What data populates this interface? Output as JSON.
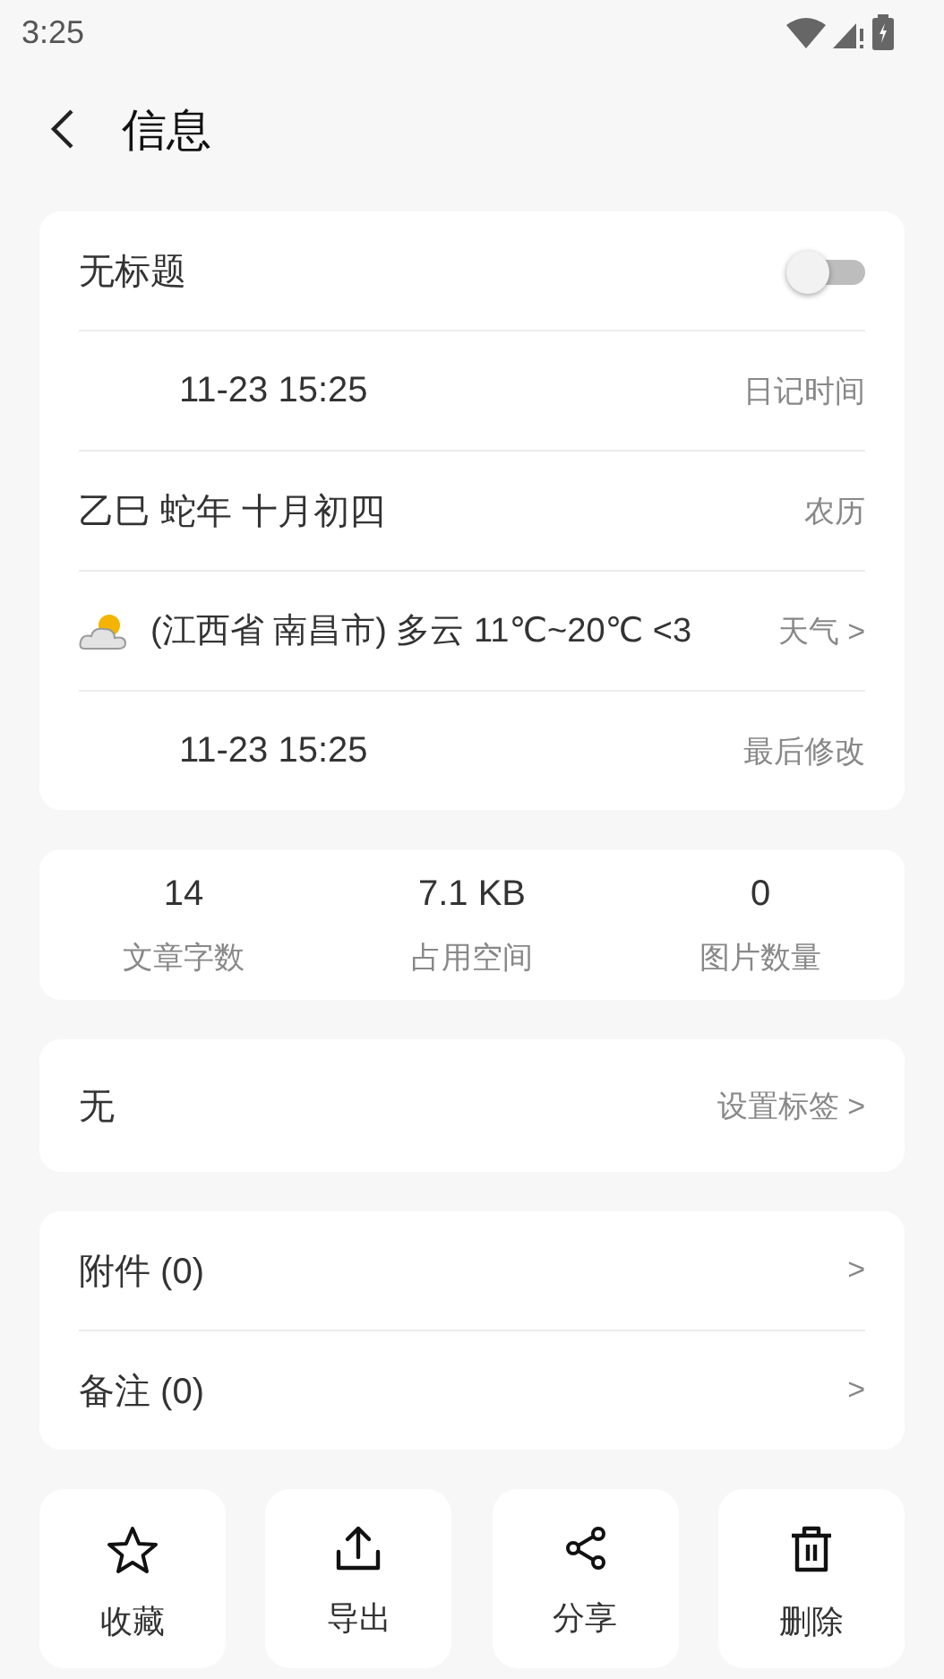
{
  "status_bar": {
    "time": "3:25"
  },
  "header": {
    "title": "信息"
  },
  "info": {
    "title": "无标题",
    "title_switch_on": false,
    "rows": [
      {
        "kind": "date",
        "value": "11-23 15:25",
        "label": "日记时间"
      },
      {
        "kind": "text",
        "value": "乙巳 蛇年 十月初四",
        "label": "农历"
      },
      {
        "kind": "weather",
        "value": "(江西省 南昌市) 多云 11℃~20℃ <3",
        "label": "天气 >"
      },
      {
        "kind": "date",
        "value": "11-23 15:25",
        "label": "最后修改"
      }
    ]
  },
  "stats": [
    {
      "value": "14",
      "label": "文章字数"
    },
    {
      "value": "7.1 KB",
      "label": "占用空间"
    },
    {
      "value": "0",
      "label": "图片数量"
    }
  ],
  "tags": {
    "value": "无",
    "action": "设置标签 >"
  },
  "links": [
    {
      "label": "附件 (0)",
      "arrow": ">"
    },
    {
      "label": "备注 (0)",
      "arrow": ">"
    }
  ],
  "actions": [
    {
      "kind": "star",
      "label": "收藏"
    },
    {
      "kind": "export",
      "label": "导出"
    },
    {
      "kind": "share",
      "label": "分享"
    },
    {
      "kind": "delete",
      "label": "删除"
    }
  ]
}
